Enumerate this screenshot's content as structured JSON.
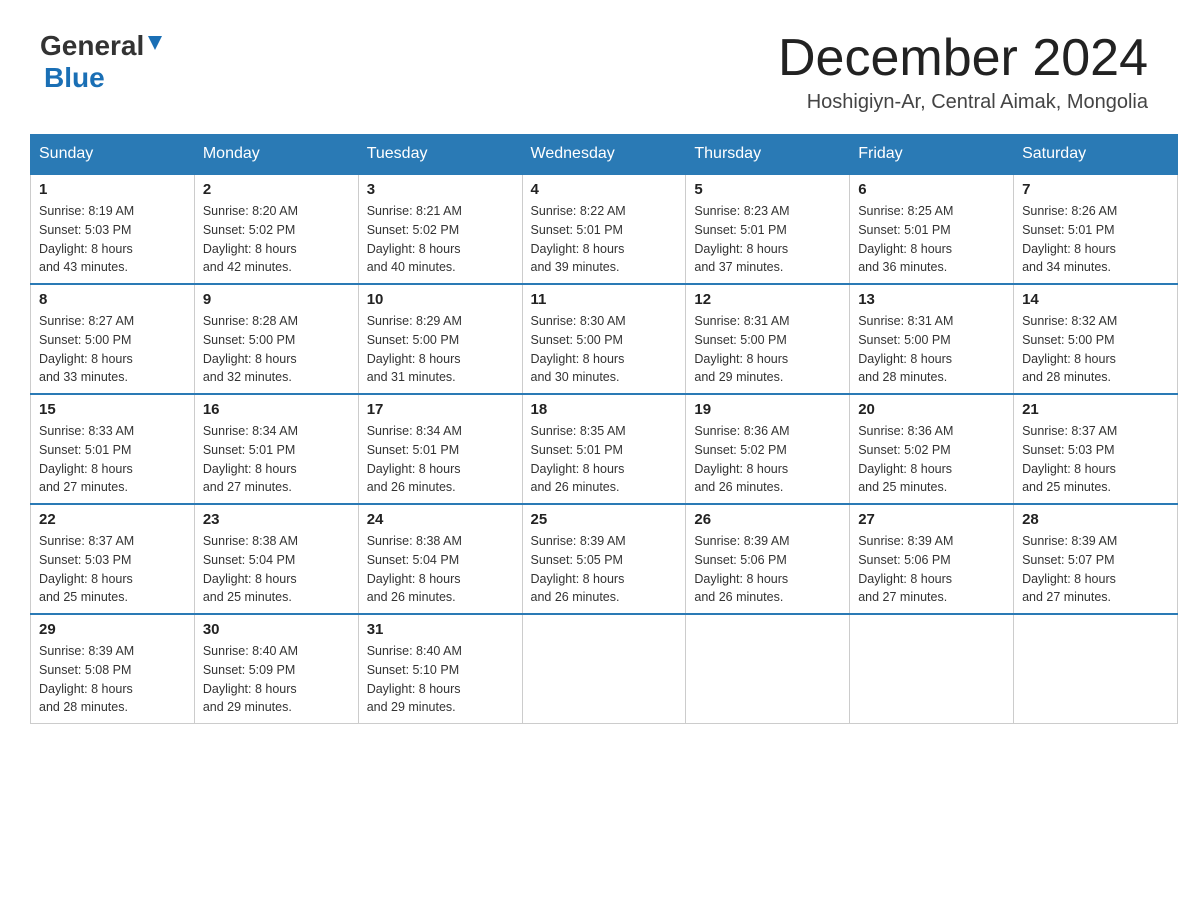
{
  "header": {
    "logo_general": "General",
    "logo_blue": "Blue",
    "month_title": "December 2024",
    "location": "Hoshigiyn-Ar, Central Aimak, Mongolia"
  },
  "days_of_week": [
    "Sunday",
    "Monday",
    "Tuesday",
    "Wednesday",
    "Thursday",
    "Friday",
    "Saturday"
  ],
  "weeks": [
    [
      {
        "day": "1",
        "sunrise": "8:19 AM",
        "sunset": "5:03 PM",
        "daylight": "8 hours and 43 minutes."
      },
      {
        "day": "2",
        "sunrise": "8:20 AM",
        "sunset": "5:02 PM",
        "daylight": "8 hours and 42 minutes."
      },
      {
        "day": "3",
        "sunrise": "8:21 AM",
        "sunset": "5:02 PM",
        "daylight": "8 hours and 40 minutes."
      },
      {
        "day": "4",
        "sunrise": "8:22 AM",
        "sunset": "5:01 PM",
        "daylight": "8 hours and 39 minutes."
      },
      {
        "day": "5",
        "sunrise": "8:23 AM",
        "sunset": "5:01 PM",
        "daylight": "8 hours and 37 minutes."
      },
      {
        "day": "6",
        "sunrise": "8:25 AM",
        "sunset": "5:01 PM",
        "daylight": "8 hours and 36 minutes."
      },
      {
        "day": "7",
        "sunrise": "8:26 AM",
        "sunset": "5:01 PM",
        "daylight": "8 hours and 34 minutes."
      }
    ],
    [
      {
        "day": "8",
        "sunrise": "8:27 AM",
        "sunset": "5:00 PM",
        "daylight": "8 hours and 33 minutes."
      },
      {
        "day": "9",
        "sunrise": "8:28 AM",
        "sunset": "5:00 PM",
        "daylight": "8 hours and 32 minutes."
      },
      {
        "day": "10",
        "sunrise": "8:29 AM",
        "sunset": "5:00 PM",
        "daylight": "8 hours and 31 minutes."
      },
      {
        "day": "11",
        "sunrise": "8:30 AM",
        "sunset": "5:00 PM",
        "daylight": "8 hours and 30 minutes."
      },
      {
        "day": "12",
        "sunrise": "8:31 AM",
        "sunset": "5:00 PM",
        "daylight": "8 hours and 29 minutes."
      },
      {
        "day": "13",
        "sunrise": "8:31 AM",
        "sunset": "5:00 PM",
        "daylight": "8 hours and 28 minutes."
      },
      {
        "day": "14",
        "sunrise": "8:32 AM",
        "sunset": "5:00 PM",
        "daylight": "8 hours and 28 minutes."
      }
    ],
    [
      {
        "day": "15",
        "sunrise": "8:33 AM",
        "sunset": "5:01 PM",
        "daylight": "8 hours and 27 minutes."
      },
      {
        "day": "16",
        "sunrise": "8:34 AM",
        "sunset": "5:01 PM",
        "daylight": "8 hours and 27 minutes."
      },
      {
        "day": "17",
        "sunrise": "8:34 AM",
        "sunset": "5:01 PM",
        "daylight": "8 hours and 26 minutes."
      },
      {
        "day": "18",
        "sunrise": "8:35 AM",
        "sunset": "5:01 PM",
        "daylight": "8 hours and 26 minutes."
      },
      {
        "day": "19",
        "sunrise": "8:36 AM",
        "sunset": "5:02 PM",
        "daylight": "8 hours and 26 minutes."
      },
      {
        "day": "20",
        "sunrise": "8:36 AM",
        "sunset": "5:02 PM",
        "daylight": "8 hours and 25 minutes."
      },
      {
        "day": "21",
        "sunrise": "8:37 AM",
        "sunset": "5:03 PM",
        "daylight": "8 hours and 25 minutes."
      }
    ],
    [
      {
        "day": "22",
        "sunrise": "8:37 AM",
        "sunset": "5:03 PM",
        "daylight": "8 hours and 25 minutes."
      },
      {
        "day": "23",
        "sunrise": "8:38 AM",
        "sunset": "5:04 PM",
        "daylight": "8 hours and 25 minutes."
      },
      {
        "day": "24",
        "sunrise": "8:38 AM",
        "sunset": "5:04 PM",
        "daylight": "8 hours and 26 minutes."
      },
      {
        "day": "25",
        "sunrise": "8:39 AM",
        "sunset": "5:05 PM",
        "daylight": "8 hours and 26 minutes."
      },
      {
        "day": "26",
        "sunrise": "8:39 AM",
        "sunset": "5:06 PM",
        "daylight": "8 hours and 26 minutes."
      },
      {
        "day": "27",
        "sunrise": "8:39 AM",
        "sunset": "5:06 PM",
        "daylight": "8 hours and 27 minutes."
      },
      {
        "day": "28",
        "sunrise": "8:39 AM",
        "sunset": "5:07 PM",
        "daylight": "8 hours and 27 minutes."
      }
    ],
    [
      {
        "day": "29",
        "sunrise": "8:39 AM",
        "sunset": "5:08 PM",
        "daylight": "8 hours and 28 minutes."
      },
      {
        "day": "30",
        "sunrise": "8:40 AM",
        "sunset": "5:09 PM",
        "daylight": "8 hours and 29 minutes."
      },
      {
        "day": "31",
        "sunrise": "8:40 AM",
        "sunset": "5:10 PM",
        "daylight": "8 hours and 29 minutes."
      },
      null,
      null,
      null,
      null
    ]
  ],
  "labels": {
    "sunrise": "Sunrise:",
    "sunset": "Sunset:",
    "daylight": "Daylight:"
  }
}
